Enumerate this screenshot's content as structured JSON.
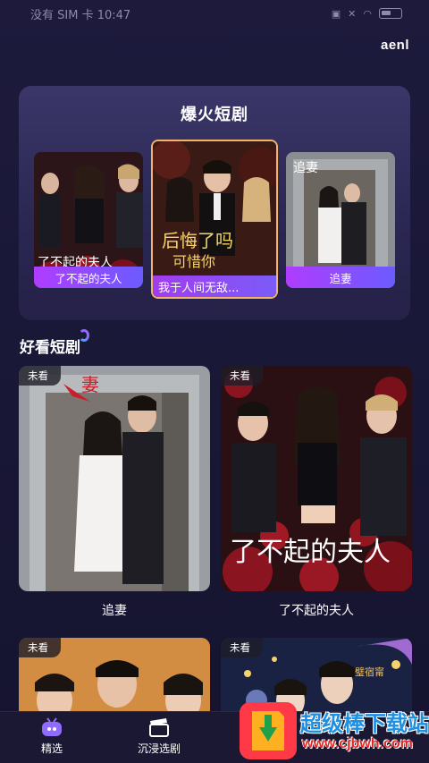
{
  "status_bar": {
    "left": "没有 SIM 卡 10:47"
  },
  "header": {
    "right_label": "aenl"
  },
  "hot_section": {
    "title": "爆火短剧",
    "items": [
      {
        "label": "了不起的夫人"
      },
      {
        "label": "我于人间无敌..."
      },
      {
        "label": "追妻"
      }
    ]
  },
  "good_section": {
    "title": "好看短剧",
    "cards": [
      {
        "badge": "未看",
        "title": "追妻"
      },
      {
        "badge": "未看",
        "title": "了不起的夫人"
      },
      {
        "badge": "未看",
        "title": ""
      },
      {
        "badge": "未看",
        "title": ""
      }
    ]
  },
  "tabbar": {
    "tabs": [
      {
        "label": "精选",
        "icon": "tv-icon",
        "active": true
      },
      {
        "label": "沉浸选剧",
        "icon": "clapperboard-icon",
        "active": false
      }
    ]
  },
  "watermark": {
    "text": "超级棒下载站",
    "url": "www.cjbwh.com"
  },
  "colors": {
    "background": "#1b1939",
    "accent_purple": "#a23cf0",
    "accent_gold": "#f2b36a"
  }
}
